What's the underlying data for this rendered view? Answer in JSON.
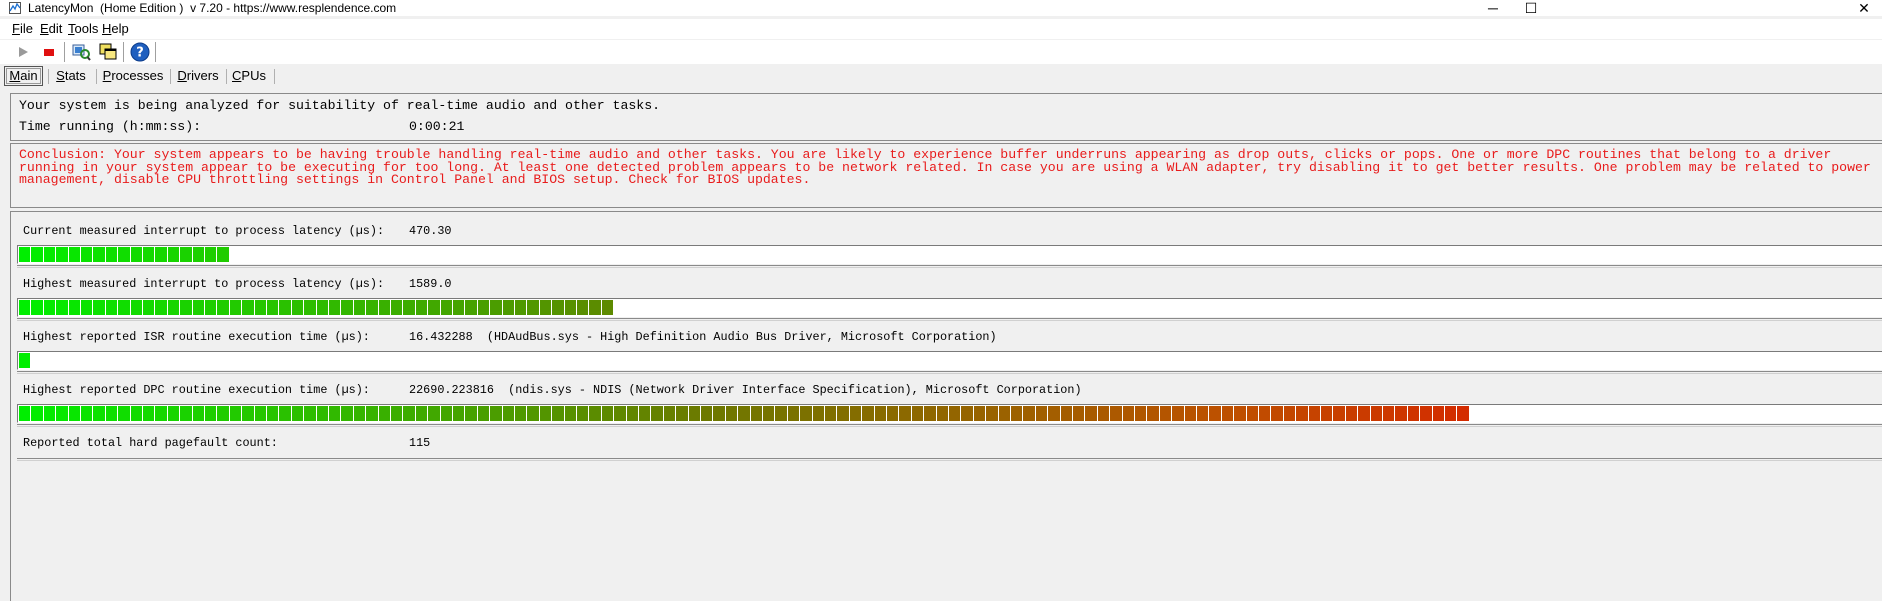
{
  "window": {
    "title": "LatencyMon  (Home Edition )  v 7.20 - https://www.resplendence.com",
    "controls": [
      "─",
      "☐",
      "✕"
    ]
  },
  "menu": [
    {
      "mn": "F",
      "rest": "ile"
    },
    {
      "mn": "E",
      "rest": "dit"
    },
    {
      "mn": "T",
      "rest": "ools"
    },
    {
      "mn": "H",
      "rest": "elp"
    }
  ],
  "toolbar": {
    "icons": [
      "play-icon",
      "stop-icon",
      "analyze-icon",
      "windows-icon",
      "help-icon"
    ],
    "help_glyph": "?"
  },
  "tabs": [
    {
      "mn": "M",
      "rest": "ain"
    },
    {
      "mn": "S",
      "rest": "tats"
    },
    {
      "mn": "P",
      "rest": "rocesses"
    },
    {
      "mn": "D",
      "rest": "rivers"
    },
    {
      "mn": "C",
      "rest": "PUs"
    }
  ],
  "status": {
    "analyzing_text": "Your system is being analyzed for suitability of real-time audio and other tasks.",
    "time_label": "Time running (h:mm:ss):",
    "time_value": "0:00:21"
  },
  "conclusion": "Conclusion: Your system appears to be having trouble handling real-time audio and other tasks. You are likely to experience buffer underruns appearing as drop outs, clicks or pops. One or more DPC routines that belong to a driver running in your system appear to be executing for too long. At least one detected problem appears to be network related. In case you are using a WLAN adapter, try disabling it to get better results. One problem may be related to power management, disable CPU throttling settings in Control Panel and BIOS setup. Check for BIOS updates.",
  "metrics": [
    {
      "label": "Current measured interrupt to process latency (µs):",
      "value": "470.30",
      "segments": 17
    },
    {
      "label": "Highest measured interrupt to process latency (µs):",
      "value": "1589.0",
      "segments": 48
    },
    {
      "label": "Highest reported ISR routine execution time (µs):",
      "value": "16.432288  (HDAudBus.sys - High Definition Audio Bus Driver, Microsoft Corporation)",
      "segments": 1
    },
    {
      "label": "Highest reported DPC routine execution time (µs):",
      "value": "22690.223816  (ndis.sys - NDIS (Network Driver Interface Specification), Microsoft Corporation)",
      "segments": 117
    },
    {
      "label": "Reported total hard pagefault count:",
      "value": "115",
      "segments": 0
    }
  ],
  "colors": {
    "conclusion_red": "#e81c1c",
    "bar_green": "#00ee00",
    "bar_red": "#ee0000"
  }
}
